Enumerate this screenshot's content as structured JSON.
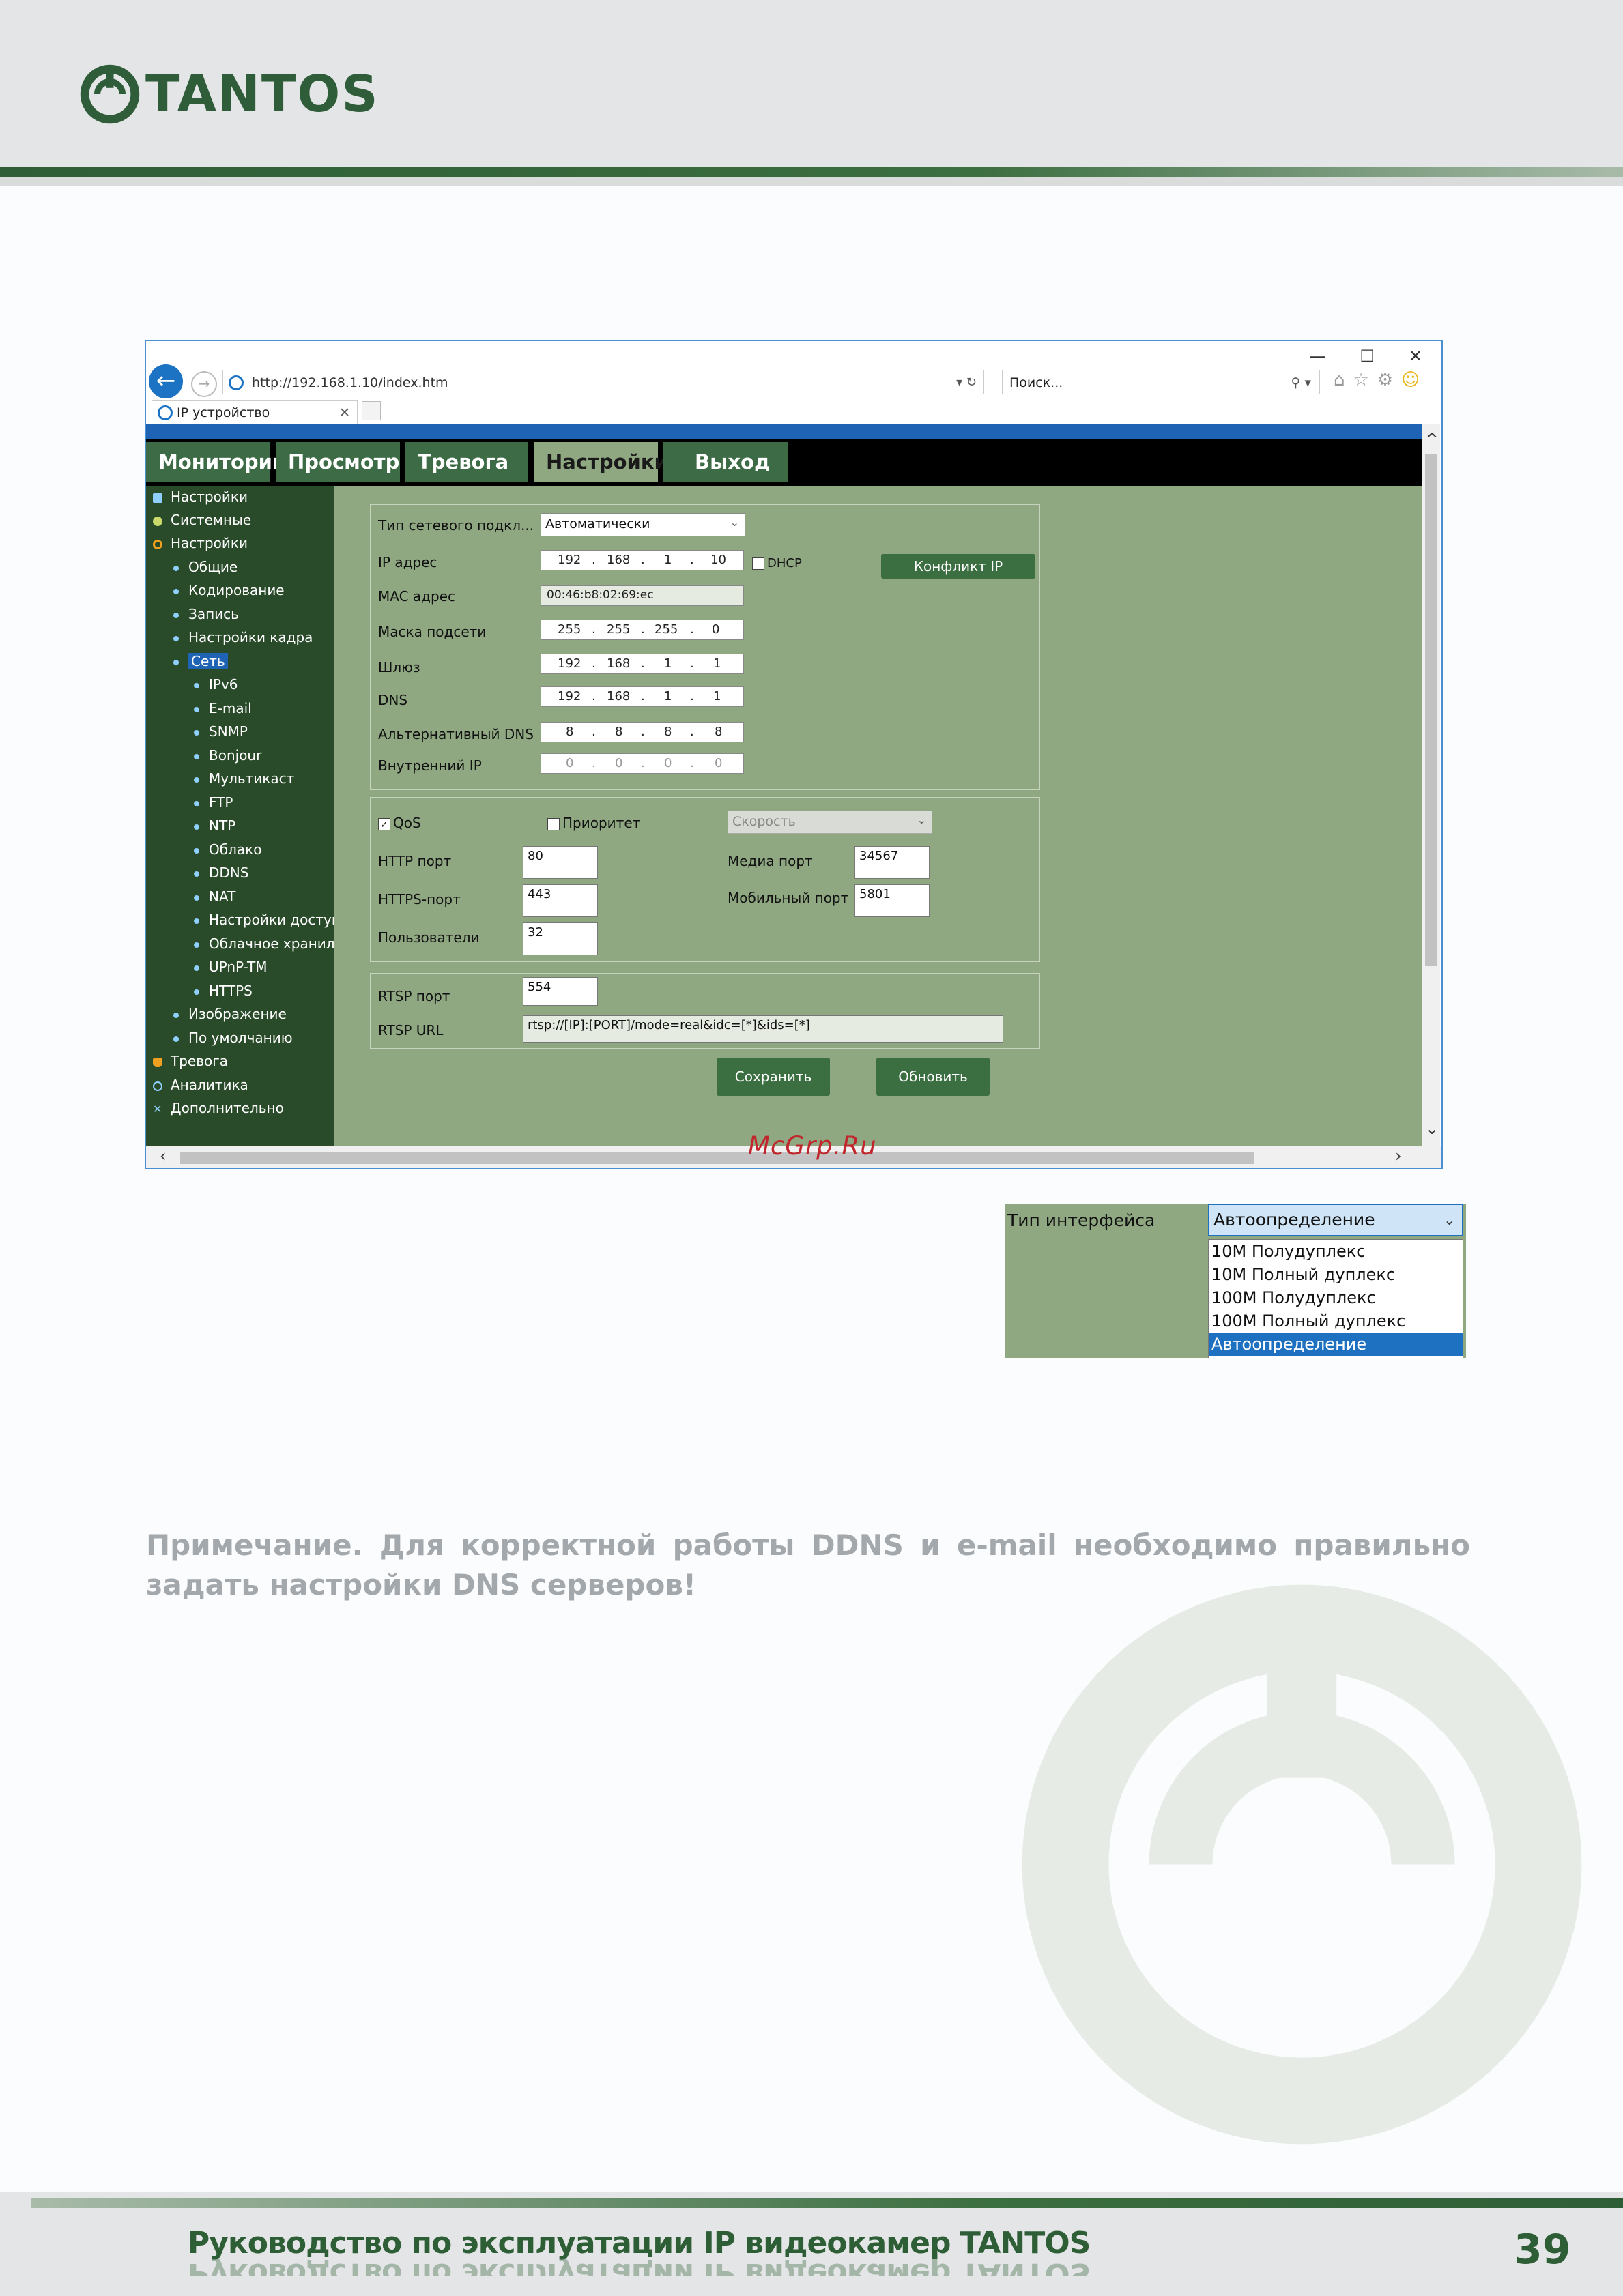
{
  "brand": {
    "name": "TANTOS",
    "color": "#2f5d3a"
  },
  "browser": {
    "url": "http://192.168.1.10/index.htm",
    "url_host": "http://192.168.1.10",
    "url_path": "/index.htm",
    "search_placeholder": "Поиск...",
    "tab_title": "IP устройство"
  },
  "menu": [
    "Мониторинг",
    "Просмотр",
    "Тревога",
    "Настройки",
    "Выход"
  ],
  "sidebar": {
    "root": [
      {
        "label": "Настройки",
        "icon": "settings-icon"
      },
      {
        "label": "Системные",
        "icon": "system-icon"
      },
      {
        "label": "Настройки",
        "icon": "gear-icon"
      }
    ],
    "level1": [
      "Общие",
      "Кодирование",
      "Запись",
      "Настройки кадра",
      "Сеть"
    ],
    "level2": [
      "IPv6",
      "E-mail",
      "SNMP",
      "Bonjour",
      "Мультикаст",
      "FTP",
      "NTP",
      "Облако",
      "DDNS",
      "NAT",
      "Настройки доступ",
      "Облачное хранил",
      "UPnP-TM",
      "HTTPS"
    ],
    "level1_tail": [
      "Изображение",
      "По умолчанию"
    ],
    "root_tail": [
      {
        "label": "Тревога",
        "icon": "bell-icon"
      },
      {
        "label": "Аналитика",
        "icon": "analytics-icon"
      },
      {
        "label": "Дополнительно",
        "icon": "tools-icon"
      }
    ]
  },
  "network": {
    "conn_type_label": "Тип сетевого подкл...",
    "conn_type_value": "Автоматически",
    "ip_label": "IP адрес",
    "ip": [
      "192",
      "168",
      "1",
      "10"
    ],
    "dhcp_label": "DHCP",
    "conflict_button": "Конфликт IP",
    "mac_label": "MAC адрес",
    "mac": "00:46:b8:02:69:ec",
    "mask_label": "Маска подсети",
    "mask": [
      "255",
      "255",
      "255",
      "0"
    ],
    "gw_label": "Шлюз",
    "gw": [
      "192",
      "168",
      "1",
      "1"
    ],
    "dns_label": "DNS",
    "dns": [
      "192",
      "168",
      "1",
      "1"
    ],
    "alt_dns_label": "Альтернативный DNS",
    "alt_dns": [
      "8",
      "8",
      "8",
      "8"
    ],
    "inner_ip_label": "Внутренний IP",
    "inner_ip": [
      "0",
      "0",
      "0",
      "0"
    ]
  },
  "ports": {
    "qos_label": "QoS",
    "priority_label": "Приоритет",
    "speed_value": "Скорость",
    "http_label": "HTTP порт",
    "http": "80",
    "https_label": "HTTPS-порт",
    "https": "443",
    "users_label": "Пользователи",
    "users": "32",
    "media_label": "Медиа порт",
    "media": "34567",
    "mobile_label": "Мобильный порт",
    "mobile": "5801"
  },
  "rtsp": {
    "port_label": "RTSP порт",
    "port": "554",
    "url_label": "RTSP URL",
    "url": "rtsp://[IP]:[PORT]/mode=real&idc=[*]&ids=[*]"
  },
  "actions": {
    "save": "Сохранить",
    "refresh": "Обновить"
  },
  "watermark_text": "McGrp.Ru",
  "interface": {
    "label": "Тип интерфейса",
    "selected": "Автоопределение",
    "options": [
      "10M Полудуплекс",
      "10M Полный дуплекс",
      "100M Полудуплекс",
      "100M Полный дуплекс",
      "Автоопределение"
    ]
  },
  "note": "Примечание. Для корректной работы DDNS и e-mail необходимо правильно задать настройки DNS серверов!",
  "footer": {
    "title": "Руководство по эксплуатации IP видеокамер TANTOS",
    "page": "39"
  }
}
